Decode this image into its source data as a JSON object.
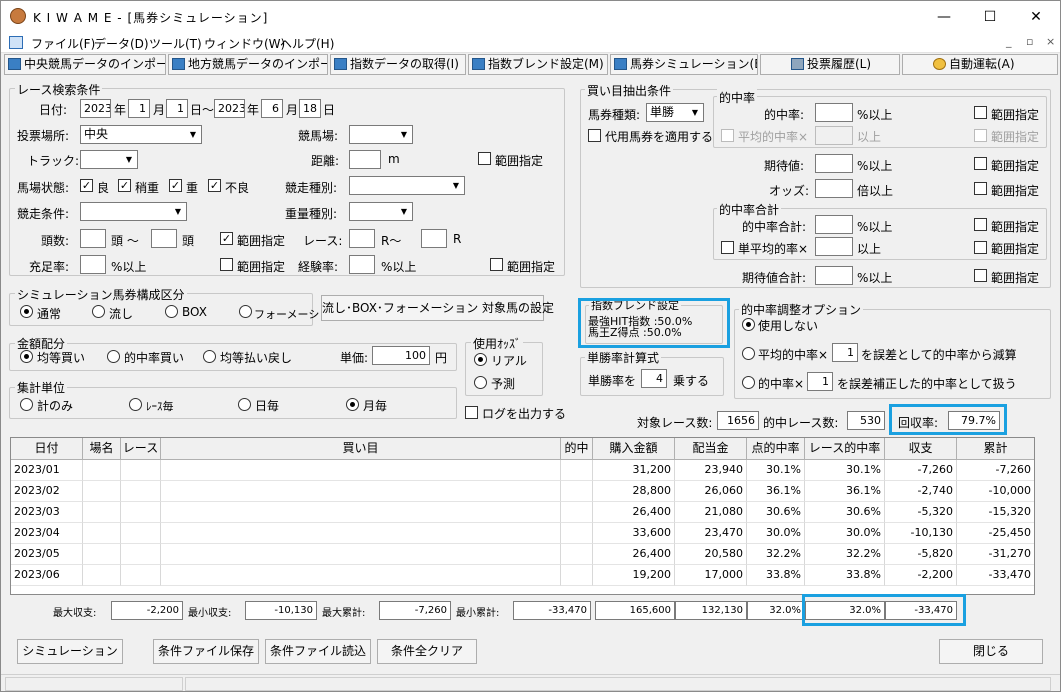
{
  "window": {
    "title": "K I W A M E - [馬券シミュレーション]",
    "minimize": "—",
    "maximize": "☐",
    "close": "✕"
  },
  "menu": [
    "ファイル(F)",
    "データ(D)",
    "ツール(T)",
    "ウィンドウ(W)",
    "ヘルプ(H)"
  ],
  "mdi": {
    "minimize": "_",
    "restore": "▫",
    "close": "×"
  },
  "toolbar": [
    "中央競馬データのインポート(J)",
    "地方競馬データのインポート(N)",
    "指数データの取得(I)",
    "指数ブレンド設定(M)",
    "馬券シミュレーション(B)",
    "投票履歴(L)",
    "自動運転(A)"
  ],
  "race": {
    "legend": "レース検索条件",
    "date_label": "日付:",
    "from_year": "2023",
    "year": "年",
    "from_month": "1",
    "month": "月",
    "from_day": "1",
    "day_tilde": "日〜",
    "to_year": "2023",
    "to_month": "6",
    "to_day": "18",
    "day": "日",
    "venue_label": "投票場所:",
    "venue": "中央",
    "course_label": "競馬場:",
    "track_label": "トラック:",
    "distance_label": "距離:",
    "distance_unit": "m",
    "range": "範囲指定",
    "condition_label": "馬場状態:",
    "cond_good": "良",
    "cond_slightly": "稍重",
    "cond_heavy": "重",
    "cond_bad": "不良",
    "race_type_label": "競走種別:",
    "race_cond_label": "競走条件:",
    "weight_label": "重量種別:",
    "heads_label": "頭数:",
    "heads_tilde": "頭 〜",
    "heads_unit": "頭",
    "race_label": "レース:",
    "race_tilde": "R〜",
    "race_unit": "R",
    "fill_label": "充足率:",
    "pct_over": "%以上",
    "exp_label": "経験率:"
  },
  "sim": {
    "legend": "シミュレーション馬券構成区分",
    "normal": "通常",
    "nagashi": "流し",
    "box": "BOX",
    "formation": "フォーメーション",
    "setting_button": "流し･BOX･フォーメーション 対象馬の設定"
  },
  "amount": {
    "legend": "金額配分",
    "equal": "均等買い",
    "hit_rate": "的中率買い",
    "payback": "均等払い戻し",
    "unit_label": "単価:",
    "unit_value": "100",
    "yen": "円"
  },
  "odds": {
    "legend": "使用ｵｯｽﾞ",
    "real": "リアル",
    "forecast": "予測"
  },
  "agg": {
    "legend": "集計単位",
    "total_only": "計のみ",
    "per_race": "ﾚｰｽ毎",
    "per_day": "日毎",
    "per_month": "月毎"
  },
  "log_label": "ログを出力する",
  "buy": {
    "legend": "買い目抽出条件",
    "type_label": "馬券種類:",
    "type": "単勝",
    "proxy": "代用馬券を適用する",
    "hit_legend": "的中率",
    "hit_rate": "的中率:",
    "pct_over": "%以上",
    "avg_hit": "平均的中率×",
    "over": "以上",
    "range": "範囲指定",
    "expect": "期待値:",
    "odds": "オッズ:",
    "times_over": "倍以上",
    "sum_legend": "的中率合計",
    "hit_sum": "的中率合計:",
    "single_avg": "単平均的率×",
    "expect_sum": "期待値合計:"
  },
  "blend": {
    "legend": "指数ブレンド設定",
    "line1": "最強HIT指数 :50.0%",
    "line2": "馬王Z得点 :50.0%"
  },
  "formula": {
    "legend": "単勝率計算式",
    "prefix": "単勝率を",
    "value": "4",
    "suffix": "乗する"
  },
  "adjust": {
    "legend": "的中率調整オプション",
    "none": "使用しない",
    "opt1_prefix": "平均的中率×",
    "opt1_value": "1",
    "opt1_suffix": "を誤差として的中率から減算",
    "opt2_prefix": "的中率×",
    "opt2_value": "1",
    "opt2_suffix": "を誤差補正した的中率として扱う"
  },
  "summary": {
    "target_label": "対象レース数:",
    "target": "1656",
    "hit_label": "的中レース数:",
    "hit": "530",
    "recovery_label": "回収率:",
    "recovery": "79.7%"
  },
  "table": {
    "headers": [
      "日付",
      "場名",
      "レース",
      "買い目",
      "的中",
      "購入金額",
      "配当金",
      "点的中率",
      "レース的中率",
      "収支",
      "累計"
    ],
    "rows": [
      [
        "2023/01",
        "",
        "",
        "",
        "",
        "31,200",
        "23,940",
        "30.1%",
        "30.1%",
        "-7,260",
        "-7,260"
      ],
      [
        "2023/02",
        "",
        "",
        "",
        "",
        "28,800",
        "26,060",
        "36.1%",
        "36.1%",
        "-2,740",
        "-10,000"
      ],
      [
        "2023/03",
        "",
        "",
        "",
        "",
        "26,400",
        "21,080",
        "30.6%",
        "30.6%",
        "-5,320",
        "-15,320"
      ],
      [
        "2023/04",
        "",
        "",
        "",
        "",
        "33,600",
        "23,470",
        "30.0%",
        "30.0%",
        "-10,130",
        "-25,450"
      ],
      [
        "2023/05",
        "",
        "",
        "",
        "",
        "26,400",
        "20,580",
        "32.2%",
        "32.2%",
        "-5,820",
        "-31,270"
      ],
      [
        "2023/06",
        "",
        "",
        "",
        "",
        "19,200",
        "17,000",
        "33.8%",
        "33.8%",
        "-2,200",
        "-33,470"
      ]
    ]
  },
  "totals": {
    "max_profit_label": "最大収支:",
    "max_profit": "-2,200",
    "min_profit_label": "最小収支:",
    "min_profit": "-10,130",
    "max_cum_label": "最大累計:",
    "max_cum": "-7,260",
    "min_cum_label": "最小累計:",
    "min_cum": "-33,470",
    "purchase": "165,600",
    "payout": "132,130",
    "point_rate": "32.0%",
    "race_rate": "32.0%",
    "balance": "-33,470"
  },
  "buttons": {
    "simulate": "シミュレーション",
    "save": "条件ファイル保存",
    "load": "条件ファイル読込",
    "clear": "条件全クリア",
    "close": "閉じる"
  }
}
